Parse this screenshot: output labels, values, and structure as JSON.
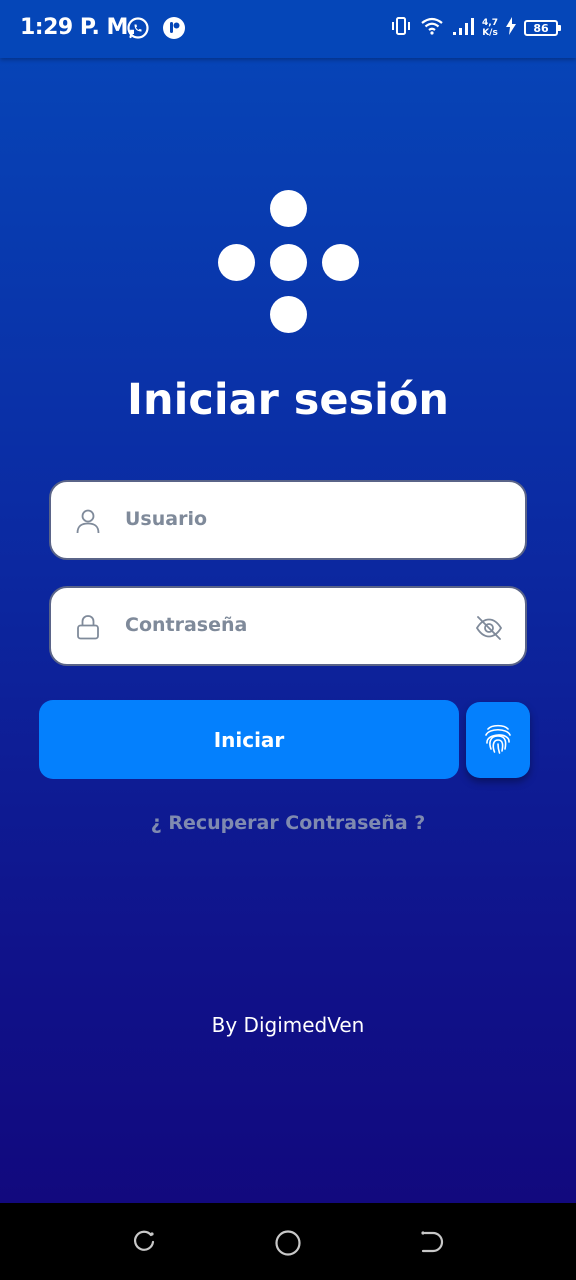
{
  "status_bar": {
    "time": "1:29 P. M.",
    "net_speed_value": "4,7",
    "net_speed_unit": "K/s",
    "battery": "86",
    "icons": [
      "whatsapp-icon",
      "app-notification-icon",
      "vibrate-icon",
      "wifi-icon",
      "signal-icon",
      "charging-icon",
      "battery-icon"
    ]
  },
  "login": {
    "title": "Iniciar sesión",
    "username_placeholder": "Usuario",
    "password_placeholder": "Contraseña",
    "submit_label": "Iniciar",
    "recover_label": "¿ Recuperar Contraseña ?",
    "credit": "By DigimedVen"
  },
  "colors": {
    "background_top": "#0647b9",
    "background_bottom": "#12067a",
    "primary_button": "#0480fd",
    "input_background": "#ffffff",
    "placeholder_text": "#7f8a9a",
    "link_text": "#7f8ab0"
  },
  "icons": {
    "username": "user-icon",
    "password": "lock-icon",
    "visibility": "eye-off-icon",
    "biometric": "fingerprint-icon"
  },
  "navigation": {
    "buttons": [
      "recent-apps-icon",
      "home-icon",
      "back-icon"
    ]
  }
}
